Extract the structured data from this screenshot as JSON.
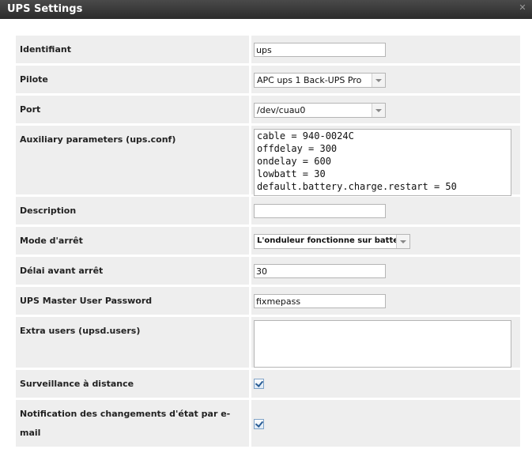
{
  "window": {
    "title": "UPS Settings",
    "close_icon": "close-icon"
  },
  "fields": {
    "identifiant": {
      "label": "Identifiant",
      "value": "ups"
    },
    "pilote": {
      "label": "Pilote",
      "value": "APC ups 1 Back-UPS Pro"
    },
    "port": {
      "label": "Port",
      "value": "/dev/cuau0"
    },
    "aux": {
      "label": "Auxiliary parameters (ups.conf)",
      "lines": [
        "cable = 940-0024C",
        "offdelay = 300",
        "ondelay = 600",
        "lowbatt = 30",
        "default.battery.charge.restart = 50"
      ]
    },
    "description": {
      "label": "Description",
      "value": ""
    },
    "mode": {
      "label": "Mode d'arrêt",
      "value": "L'onduleur fonctionne sur batterie"
    },
    "delai": {
      "label": "Délai avant arrêt",
      "value": "30"
    },
    "password": {
      "label": "UPS Master User Password",
      "value": "fixmepass"
    },
    "extra_users": {
      "label": "Extra users (upsd.users)",
      "value": ""
    },
    "remote": {
      "label": "Surveillance à distance",
      "checked": true
    },
    "email": {
      "label": "Notification des changements d'état par e-mail",
      "checked": true
    }
  }
}
